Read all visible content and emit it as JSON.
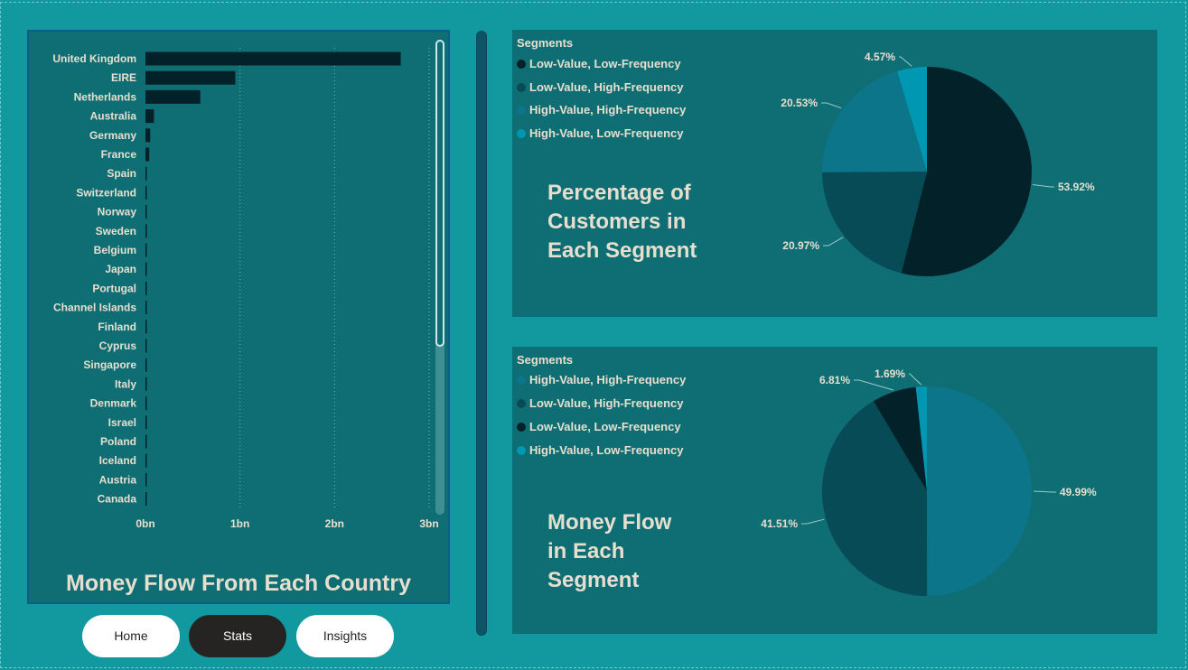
{
  "colors": {
    "background": "#11999f",
    "panel": "#0f6e73",
    "bar": "#032128",
    "text": "#e6dfcf",
    "seg_low_low": "#032128",
    "seg_low_high": "#074b57",
    "seg_high_high": "#0c7589",
    "seg_high_low": "#0097b2"
  },
  "bar_chart": {
    "title": "Money Flow From Each Country",
    "chart_data": {
      "type": "bar",
      "orientation": "horizontal",
      "categories": [
        "United Kingdom",
        "EIRE",
        "Netherlands",
        "Australia",
        "Germany",
        "France",
        "Spain",
        "Switzerland",
        "Norway",
        "Sweden",
        "Belgium",
        "Japan",
        "Portugal",
        "Channel Islands",
        "Finland",
        "Cyprus",
        "Singapore",
        "Italy",
        "Denmark",
        "Israel",
        "Poland",
        "Iceland",
        "Austria",
        "Canada"
      ],
      "values": [
        2.7,
        0.95,
        0.58,
        0.09,
        0.05,
        0.04,
        0.012,
        0.01,
        0.009,
        0.008,
        0.007,
        0.006,
        0.005,
        0.005,
        0.004,
        0.004,
        0.004,
        0.003,
        0.003,
        0.003,
        0.002,
        0.002,
        0.002,
        0.002
      ],
      "unit": "bn",
      "xlim": [
        0,
        3
      ],
      "xticks": [
        "0bn",
        "1bn",
        "2bn",
        "3bn"
      ],
      "grid": "vertical dotted"
    }
  },
  "pie1": {
    "title_lines": [
      "Percentage of",
      "Customers in",
      "Each Segment"
    ],
    "legend_title": "Segments",
    "chart_data": {
      "type": "pie",
      "slices": [
        {
          "name": "Low-Value, Low-Frequency",
          "value": 53.92,
          "label": "53.92%",
          "color": "#032128"
        },
        {
          "name": "Low-Value, High-Frequency",
          "value": 20.97,
          "label": "20.97%",
          "color": "#074b57"
        },
        {
          "name": "High-Value, High-Frequency",
          "value": 20.53,
          "label": "20.53%",
          "color": "#0c7589"
        },
        {
          "name": "High-Value, Low-Frequency",
          "value": 4.57,
          "label": "4.57%",
          "color": "#0097b2"
        }
      ]
    }
  },
  "pie2": {
    "title_lines": [
      "Money Flow",
      "in Each",
      "Segment"
    ],
    "legend_title": "Segments",
    "chart_data": {
      "type": "pie",
      "slices": [
        {
          "name": "High-Value, High-Frequency",
          "value": 49.99,
          "label": "49.99%",
          "color": "#0c7589"
        },
        {
          "name": "Low-Value, High-Frequency",
          "value": 41.51,
          "label": "41.51%",
          "color": "#074b57"
        },
        {
          "name": "Low-Value, Low-Frequency",
          "value": 6.81,
          "label": "6.81%",
          "color": "#032128"
        },
        {
          "name": "High-Value, Low-Frequency",
          "value": 1.69,
          "label": "1.69%",
          "color": "#0097b2"
        }
      ]
    }
  },
  "nav": {
    "home": "Home",
    "stats": "Stats",
    "insights": "Insights",
    "active": "Stats"
  }
}
